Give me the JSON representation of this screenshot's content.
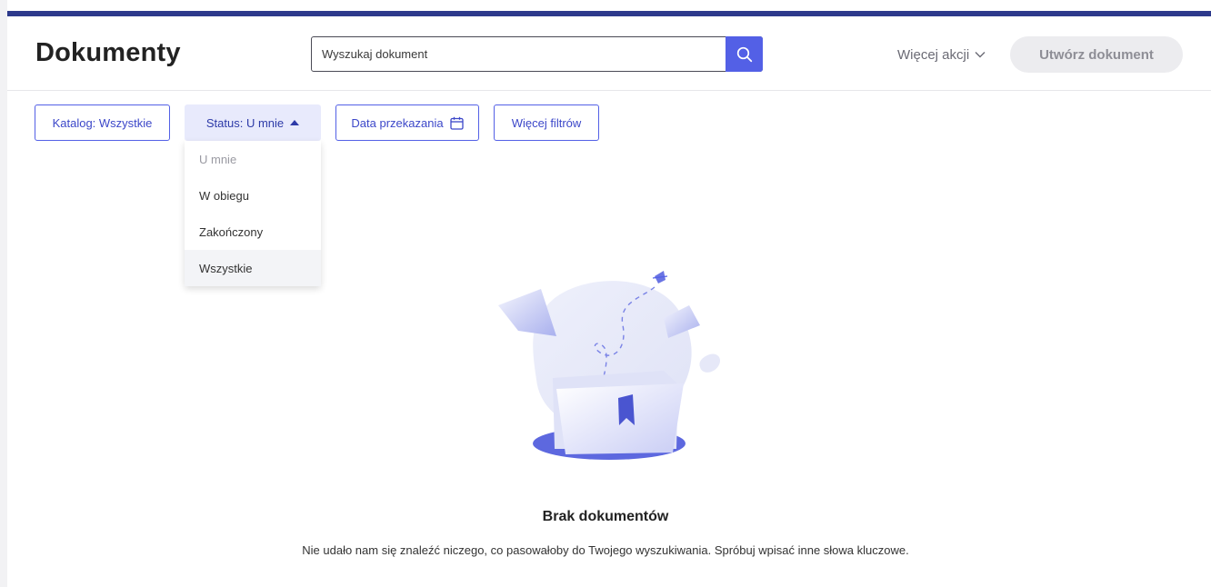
{
  "header": {
    "title": "Dokumenty",
    "search_placeholder": "Wyszukaj dokument",
    "search_value": "",
    "more_actions_label": "Więcej akcji",
    "create_button_label": "Utwórz dokument"
  },
  "filters": {
    "katalog_label": "Katalog: Wszystkie",
    "status_label": "Status: U mnie",
    "date_label": "Data przekazania",
    "more_filters_label": "Więcej filtrów"
  },
  "status_dropdown": {
    "options": [
      "U mnie",
      "W obiegu",
      "Zakończony",
      "Wszystkie"
    ],
    "selected": "U mnie"
  },
  "empty_state": {
    "title": "Brak dokumentów",
    "description": "Nie udało nam się znaleźć niczego, co pasowałoby do Twojego wyszukiwania. Spróbuj wpisać inne słowa kluczowe."
  },
  "colors": {
    "accent": "#5360e6",
    "top_bar": "#2d3a8c",
    "status_filter_bg": "#e8eafc"
  }
}
